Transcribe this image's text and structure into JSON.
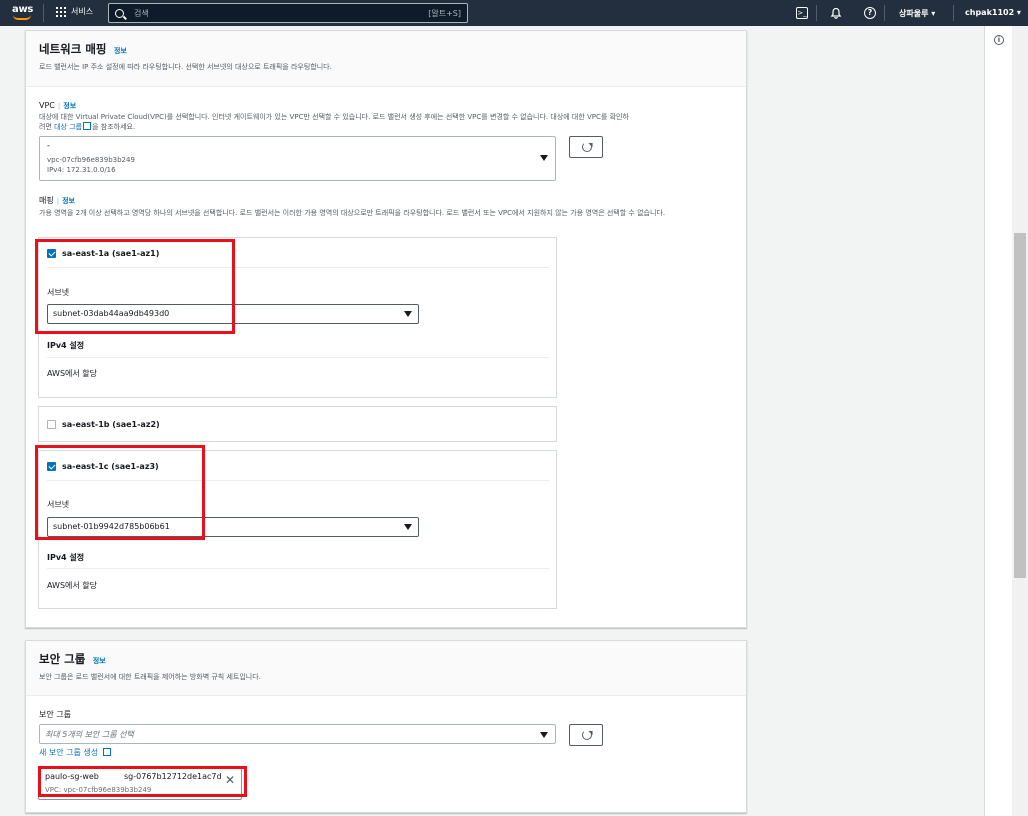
{
  "nav": {
    "logo": "aws",
    "services": "서비스",
    "search_placeholder": "검색",
    "search_shortcut": "[알트+S]",
    "region": "상파울루 ▾",
    "account": "chpak1102 ▾"
  },
  "network": {
    "title": "네트워크 매핑",
    "info": "정보",
    "desc": "로드 밸런서는 IP 주소 설정에 따라 라우팅합니다. 선택한 서브넷의 대상으로 트래픽을 라우팅합니다.",
    "vpc_label": "VPC",
    "vpc_info": "정보",
    "vpc_desc_1": "대상에 대한 Virtual Private Cloud(VPC)를 선택합니다. 인터넷 게이트웨이가 있는 VPC만 선택할 수 있습니다. 로드 밸런서 생성 후에는 선택한 VPC를 변경할 수 없습니다. 대상에 대한 VPC를 확인하",
    "vpc_desc_2a": "려면 ",
    "vpc_desc_link": "대상 그룹",
    "vpc_desc_2b": "을 참조하세요.",
    "vpc_select_name": "-",
    "vpc_select_id": "vpc-07cfb96e839b3b249",
    "vpc_select_cidr": "IPv4: 172.31.0.0/16",
    "mapping_label": "매핑",
    "mapping_info": "정보",
    "mapping_desc": "가용 영역을 2개 이상 선택하고 영역당 하나의 서브넷을 선택합니다. 로드 밸런서는 이러한 가용 영역의 대상으로만 트래픽을 라우팅합니다. 로드 밸런서 또는 VPC에서 지원하지 않는 가용 영역은 선택할 수 없습니다.",
    "zones": [
      {
        "name": "sa-east-1a (sae1-az1)",
        "checked": true,
        "subnet_label": "서브넷",
        "subnet": "subnet-03dab44aa9db493d0",
        "ipv4_label": "IPv4 설정",
        "ipv4_value": "AWS에서 할당"
      },
      {
        "name": "sa-east-1b (sae1-az2)",
        "checked": false
      },
      {
        "name": "sa-east-1c (sae1-az3)",
        "checked": true,
        "subnet_label": "서브넷",
        "subnet": "subnet-01b9942d785b06b61",
        "ipv4_label": "IPv4 설정",
        "ipv4_value": "AWS에서 할당"
      }
    ]
  },
  "security": {
    "title": "보안 그룹",
    "info": "정보",
    "desc": "보안 그룹은 로드 밸런서에 대한 트래픽을 제어하는 방화벽 규칙 세트입니다.",
    "label": "보안 그룹",
    "placeholder": "최대 5개의 보안 그룹 선택",
    "create_link": "새 보안 그룹 생성",
    "token_name": "paulo-sg-web",
    "token_id": "sg-0767b12712de1ac7d",
    "token_vpc": "VPC: vpc-07cfb96e839b3b249"
  },
  "colors": {
    "nav_bg": "#232f3e",
    "link": "#0073bb",
    "checkbox": "#0073bb",
    "highlight": "#e8111b"
  }
}
